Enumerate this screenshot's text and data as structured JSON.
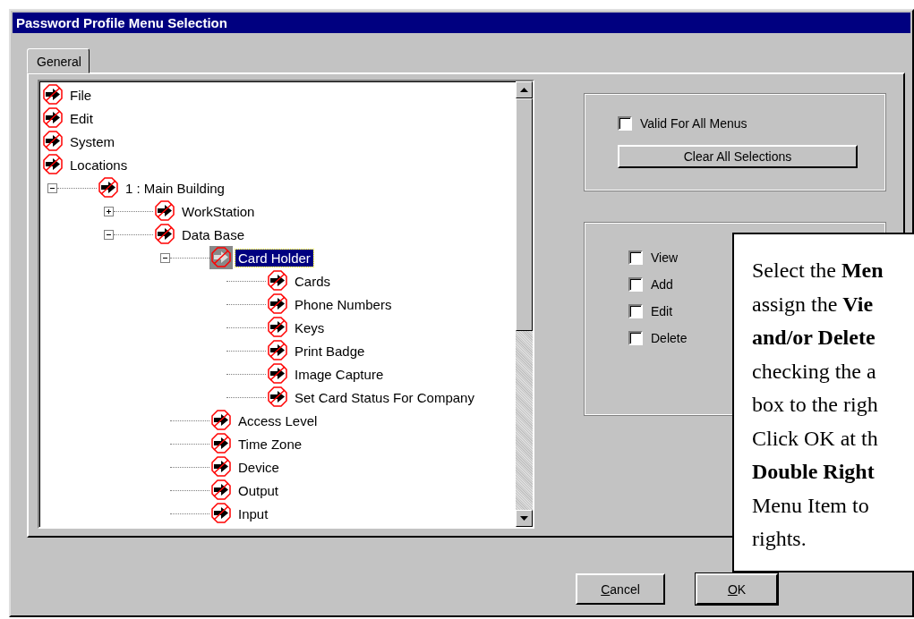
{
  "window": {
    "title": "Password Profile Menu Selection"
  },
  "tabs": [
    {
      "label": "General",
      "selected": true
    }
  ],
  "tree": {
    "items": [
      {
        "label": "File",
        "selected": false
      },
      {
        "label": "Edit",
        "selected": false
      },
      {
        "label": "System",
        "selected": false
      },
      {
        "label": "Locations",
        "selected": false,
        "children": [
          {
            "label": "1 : Main Building",
            "selected": false,
            "expanded": true,
            "children": [
              {
                "label": "WorkStation",
                "selected": false,
                "expanded": false
              },
              {
                "label": "Data Base",
                "selected": false,
                "expanded": true,
                "children": [
                  {
                    "label": "Card Holder",
                    "selected": true,
                    "expanded": true,
                    "children": [
                      {
                        "label": "Cards",
                        "selected": false
                      },
                      {
                        "label": "Phone Numbers",
                        "selected": false
                      },
                      {
                        "label": "Keys",
                        "selected": false
                      },
                      {
                        "label": "Print Badge",
                        "selected": false
                      },
                      {
                        "label": "Image Capture",
                        "selected": false
                      },
                      {
                        "label": "Set Card Status For Company",
                        "selected": false
                      }
                    ]
                  },
                  {
                    "label": "Access Level",
                    "selected": false
                  },
                  {
                    "label": "Time Zone",
                    "selected": false
                  },
                  {
                    "label": "Device",
                    "selected": false
                  },
                  {
                    "label": "Output",
                    "selected": false
                  },
                  {
                    "label": "Input",
                    "selected": false
                  }
                ]
              }
            ]
          }
        ]
      }
    ]
  },
  "valid_for_all": {
    "label": "Valid For All Menus",
    "checked": false
  },
  "clear_button": "Clear All Selections",
  "permissions": [
    {
      "label": "View",
      "checked": false
    },
    {
      "label": "Add",
      "checked": false
    },
    {
      "label": "Edit",
      "checked": false
    },
    {
      "label": "Delete",
      "checked": false
    }
  ],
  "buttons": [
    "Cancel",
    "OK"
  ],
  "callout": [
    "Select the **Men**",
    "assign the **Vie**",
    "**and/or Delete**",
    "checking the a",
    "box to the righ",
    "Click OK at th",
    "**Double Right**",
    "Menu Item to",
    "rights."
  ]
}
